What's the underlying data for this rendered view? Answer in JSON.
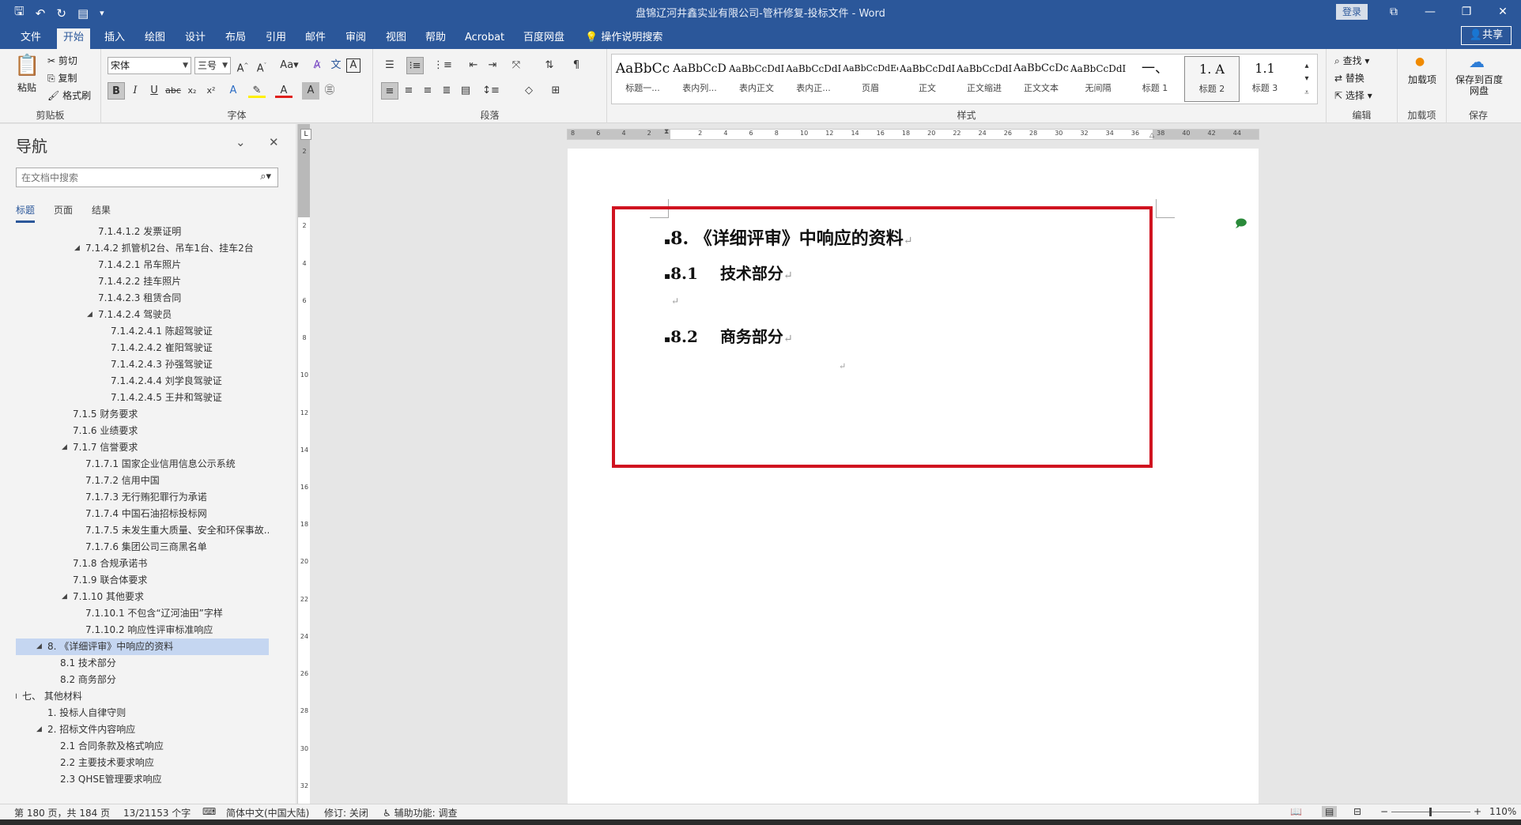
{
  "title_bar": {
    "document_title": "盘锦辽河井鑫实业有限公司-管杆修复-投标文件  -  Word",
    "login_label": "登录",
    "qat_icons": [
      "save-icon",
      "undo-icon",
      "redo-icon",
      "customize-icon"
    ]
  },
  "menu": {
    "tabs": [
      {
        "label": "文件"
      },
      {
        "label": "开始"
      },
      {
        "label": "插入"
      },
      {
        "label": "绘图"
      },
      {
        "label": "设计"
      },
      {
        "label": "布局"
      },
      {
        "label": "引用"
      },
      {
        "label": "邮件"
      },
      {
        "label": "审阅"
      },
      {
        "label": "视图"
      },
      {
        "label": "帮助"
      },
      {
        "label": "Acrobat"
      },
      {
        "label": "百度网盘"
      },
      {
        "label": "操作说明搜索"
      }
    ],
    "active_tab": "开始",
    "share_label": "共享"
  },
  "ribbon": {
    "clipboard": {
      "paste": "粘贴",
      "cut": "剪切",
      "copy": "复制",
      "format_painter": "格式刷",
      "group_label": "剪贴板"
    },
    "font": {
      "font_name": "宋体",
      "font_size": "三号",
      "group_label": "字体"
    },
    "paragraph": {
      "group_label": "段落"
    },
    "styles": {
      "group_label": "样式",
      "items": [
        {
          "sample": "AaBbCc",
          "name": "标题一..."
        },
        {
          "sample": "AaBbCcD",
          "name": "表内列..."
        },
        {
          "sample": "AaBbCcDdI",
          "name": "表内正文"
        },
        {
          "sample": "AaBbCcDdI",
          "name": "表内正..."
        },
        {
          "sample": "AaBbCcDdEe",
          "name": "页眉"
        },
        {
          "sample": "AaBbCcDdI",
          "name": "正文"
        },
        {
          "sample": "AaBbCcDdI",
          "name": "正文缩进"
        },
        {
          "sample": "AaBbCcDc",
          "name": "正文文本"
        },
        {
          "sample": "AaBbCcDdI",
          "name": "无间隔"
        },
        {
          "sample": "一、",
          "name": "标题 1"
        },
        {
          "sample": "1.    A",
          "name": "标题 2"
        },
        {
          "sample": "1.1",
          "name": "标题 3"
        }
      ],
      "selected_index": 10
    },
    "editing": {
      "find": "查找",
      "replace": "替换",
      "select": "选择",
      "group_label": "编辑"
    },
    "addins": {
      "button": "加载项",
      "group_label": "加载项"
    },
    "save": {
      "button": "保存到百度网盘",
      "group_label": "保存"
    }
  },
  "nav": {
    "title": "导航",
    "search_placeholder": "在文档中搜索",
    "tabs": [
      "标题",
      "页面",
      "结果"
    ],
    "active_tab": "标题",
    "items": [
      {
        "text": "7.1.4.1.2 发票证明",
        "level": 5,
        "tri": ""
      },
      {
        "text": "7.1.4.2 抓管机2台、吊车1台、挂车2台",
        "level": 4,
        "tri": "◢"
      },
      {
        "text": "7.1.4.2.1 吊车照片",
        "level": 5,
        "tri": ""
      },
      {
        "text": "7.1.4.2.2 挂车照片",
        "level": 5,
        "tri": ""
      },
      {
        "text": "7.1.4.2.3 租赁合同",
        "level": 5,
        "tri": ""
      },
      {
        "text": "7.1.4.2.4 驾驶员",
        "level": 5,
        "tri": "◢"
      },
      {
        "text": "7.1.4.2.4.1 陈超驾驶证",
        "level": 6,
        "tri": ""
      },
      {
        "text": "7.1.4.2.4.2 崔阳驾驶证",
        "level": 6,
        "tri": ""
      },
      {
        "text": "7.1.4.2.4.3 孙强驾驶证",
        "level": 6,
        "tri": ""
      },
      {
        "text": "7.1.4.2.4.4 刘学良驾驶证",
        "level": 6,
        "tri": ""
      },
      {
        "text": "7.1.4.2.4.5 王井和驾驶证",
        "level": 6,
        "tri": ""
      },
      {
        "text": "7.1.5 财务要求",
        "level": 3,
        "tri": ""
      },
      {
        "text": "7.1.6 业绩要求",
        "level": 3,
        "tri": ""
      },
      {
        "text": "7.1.7 信誉要求",
        "level": 3,
        "tri": "◢"
      },
      {
        "text": "7.1.7.1 国家企业信用信息公示系统",
        "level": 4,
        "tri": ""
      },
      {
        "text": "7.1.7.2 信用中国",
        "level": 4,
        "tri": ""
      },
      {
        "text": "7.1.7.3 无行贿犯罪行为承诺",
        "level": 4,
        "tri": ""
      },
      {
        "text": "7.1.7.4 中国石油招标投标网",
        "level": 4,
        "tri": ""
      },
      {
        "text": "7.1.7.5 未发生重大质量、安全和环保事故...",
        "level": 4,
        "tri": ""
      },
      {
        "text": "7.1.7.6 集团公司三商黑名单",
        "level": 4,
        "tri": ""
      },
      {
        "text": "7.1.8 合规承诺书",
        "level": 3,
        "tri": ""
      },
      {
        "text": "7.1.9 联合体要求",
        "level": 3,
        "tri": ""
      },
      {
        "text": "7.1.10 其他要求",
        "level": 3,
        "tri": "◢"
      },
      {
        "text": "7.1.10.1 不包含“辽河油田”字样",
        "level": 4,
        "tri": ""
      },
      {
        "text": "7.1.10.2 响应性评审标准响应",
        "level": 4,
        "tri": ""
      },
      {
        "text": "8. 《详细评审》中响应的资料",
        "level": 1,
        "tri": "◢"
      },
      {
        "text": "8.1 技术部分",
        "level": 2,
        "tri": ""
      },
      {
        "text": "8.2 商务部分",
        "level": 2,
        "tri": ""
      },
      {
        "text": "七、 其他材料",
        "level": 0,
        "tri": "◢"
      },
      {
        "text": "1. 投标人自律守则",
        "level": 1,
        "tri": ""
      },
      {
        "text": "2. 招标文件内容响应",
        "level": 1,
        "tri": "◢"
      },
      {
        "text": "2.1 合同条款及格式响应",
        "level": 2,
        "tri": ""
      },
      {
        "text": "2.2 主要技术要求响应",
        "level": 2,
        "tri": ""
      },
      {
        "text": "2.3 QHSE管理要求响应",
        "level": 2,
        "tri": ""
      }
    ],
    "selected_index": 25
  },
  "document": {
    "heading_8": "8. 《详细评审》中响应的资料",
    "heading_81_num": "8.1",
    "heading_81_text": "技术部分",
    "heading_82_num": "8.2",
    "heading_82_text": "商务部分",
    "para_mark": "↵",
    "bullet": "▪",
    "highlight_color": "#d01320"
  },
  "rulers": {
    "horizontal_labels": [
      "8",
      "6",
      "4",
      "2",
      "",
      "2",
      "4",
      "6",
      "8",
      "10",
      "12",
      "14",
      "16",
      "18",
      "20",
      "22",
      "24",
      "26",
      "28",
      "30",
      "32",
      "34",
      "36",
      "38",
      "40",
      "42",
      "44"
    ],
    "vertical_labels": [
      "2",
      "",
      "2",
      "4",
      "6",
      "8",
      "10",
      "12",
      "14",
      "16",
      "18",
      "20",
      "22",
      "24",
      "26",
      "28",
      "30",
      "32"
    ]
  },
  "status": {
    "page_info": "第 180 页，共 184 页",
    "word_count": "13/21153 个字",
    "language": "简体中文(中国大陆)",
    "revision": "修订: 关闭",
    "accessibility": "辅助功能: 调查",
    "zoom_level": "110%"
  },
  "colors": {
    "word_blue": "#2b579a",
    "nav_selected": "#c5d6f1",
    "highlight_box": "#d01320"
  }
}
